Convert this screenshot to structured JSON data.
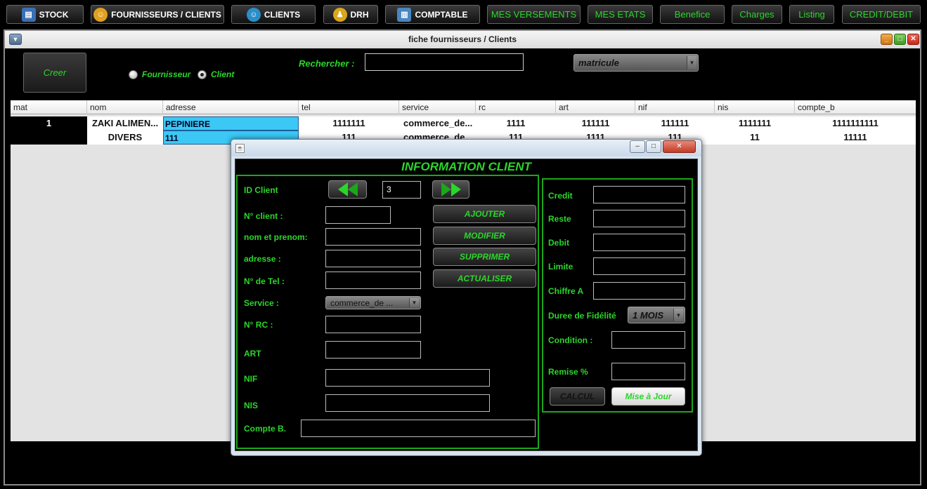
{
  "nav": {
    "items": [
      {
        "label": "STOCK",
        "icon": "stock-icon"
      },
      {
        "label": "FOURNISSEURS / CLIENTS",
        "icon": "people-icon"
      },
      {
        "label": "CLIENTS",
        "icon": "client-icon"
      },
      {
        "label": "DRH",
        "icon": "drh-icon"
      },
      {
        "label": "COMPTABLE",
        "icon": "ledger-icon"
      },
      {
        "label": "MES VERSEMENTS"
      },
      {
        "label": "MES ETATS"
      },
      {
        "label": "Benefice"
      },
      {
        "label": "Charges"
      },
      {
        "label": "Listing"
      },
      {
        "label": "CREDIT/DEBIT"
      }
    ]
  },
  "main_window": {
    "title": "fiche fournisseurs / Clients",
    "creer_label": "Creer",
    "radio_fournisseur": "Fournisseur",
    "radio_client": "Client",
    "radio_selected": "client",
    "search_label": "Rechercher :",
    "search_value": "",
    "search_field_combo": "matricule"
  },
  "table": {
    "columns": [
      "mat",
      "nom",
      "adresse",
      "tel",
      "service",
      "rc",
      "art",
      "nif",
      "nis",
      "compte_b"
    ],
    "rows": [
      {
        "mat": "1",
        "nom": "ZAKI ALIMEN...",
        "adresse": "PEPINIERE",
        "tel": "1111111",
        "service": "commerce_de...",
        "rc": "1111",
        "art": "111111",
        "nif": "111111",
        "nis": "1111111",
        "compte_b": "1111111111"
      },
      {
        "mat": "",
        "nom": "DIVERS",
        "adresse": "111",
        "tel": "111",
        "service": "commerce_de...",
        "rc": "111",
        "art": "1111",
        "nif": "111",
        "nis": "11",
        "compte_b": "11111"
      }
    ]
  },
  "dialog": {
    "title": "",
    "heading": "INFORMATION CLIENT",
    "id_client_label": "ID Client",
    "id_client_value": "3",
    "fields": {
      "num_client": {
        "label": "N° client :",
        "value": ""
      },
      "nom_prenom": {
        "label": "nom et prenom:",
        "value": ""
      },
      "adresse": {
        "label": "adresse :",
        "value": ""
      },
      "tel": {
        "label": "N° de Tel :",
        "value": ""
      },
      "service": {
        "label": "Service :",
        "value": "commerce_de ..."
      },
      "rc": {
        "label": "N° RC :",
        "value": ""
      },
      "art": {
        "label": "ART",
        "value": ""
      },
      "nif": {
        "label": "NIF",
        "value": ""
      },
      "nis": {
        "label": "NIS",
        "value": ""
      },
      "compte_b": {
        "label": "Compte B.",
        "value": ""
      }
    },
    "actions": {
      "ajouter": "AJOUTER",
      "modifier": "MODIFIER",
      "supprimer": "SUPPRIMER",
      "actualiser": "ACTUALISER"
    },
    "right_panel": {
      "credit": "Credit",
      "reste": "Reste",
      "debit": "Debit",
      "limite": "Limite",
      "chiffre_a": "Chiffre A",
      "duree_label": "Duree de Fidélité",
      "duree_value": "1 MOIS",
      "condition": "Condition :",
      "remise": "Remise %",
      "calcul": "CALCUL",
      "mise_a_jour": "Mise à Jour"
    }
  },
  "colors": {
    "accent_green": "#2bd62b",
    "selection_blue": "#3bc8f5",
    "panel_border": "#1aa81a"
  }
}
